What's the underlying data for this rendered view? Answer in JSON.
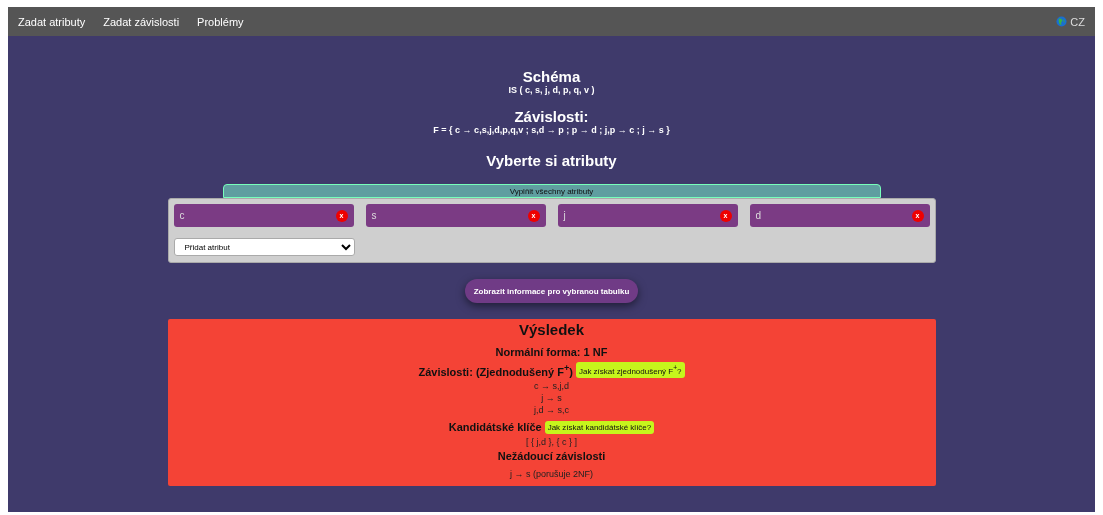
{
  "nav": {
    "links": [
      "Zadat atributy",
      "Zadat závislosti",
      "Problémy"
    ],
    "language": "CZ"
  },
  "schema": {
    "title": "Schéma",
    "value": "IS ( c, s, j, d, p, q, v )"
  },
  "dependencies": {
    "title": "Závislosti:",
    "value": "F = { c → c,s,j,d,p,q,v ; s,d → p ; p → d ; j,p → c ; j → s }"
  },
  "select_title": "Vyberte si atributy",
  "fill_all_button": "Vyplňit všechny atributy",
  "attributes": [
    {
      "name": "c",
      "remove": "x"
    },
    {
      "name": "s",
      "remove": "x"
    },
    {
      "name": "j",
      "remove": "x"
    },
    {
      "name": "d",
      "remove": "x"
    }
  ],
  "add_attribute": {
    "value": "Přidat atribut"
  },
  "info_button": "Zobrazit informace pro vybranou tabulku",
  "result": {
    "title": "Výsledek",
    "normal_form": "Normální forma: 1 NF",
    "dependencies_title": "Závislosti: (Zjednodušený F$^{+}$)",
    "dependencies_help": "Jak získat zjednodušený F$^{+}$?",
    "dependencies": [
      "c → s,j,d",
      "j → s",
      "j,d → s,c"
    ],
    "keys_title": "Kandidátské klíče",
    "keys_help": "Jak získat kandidátské klíče?",
    "keys": "[ { j,d }, { c } ]",
    "unwanted_title": "Nežádoucí závislosti",
    "unwanted": [
      "j → s (porušuje 2NF)"
    ]
  }
}
